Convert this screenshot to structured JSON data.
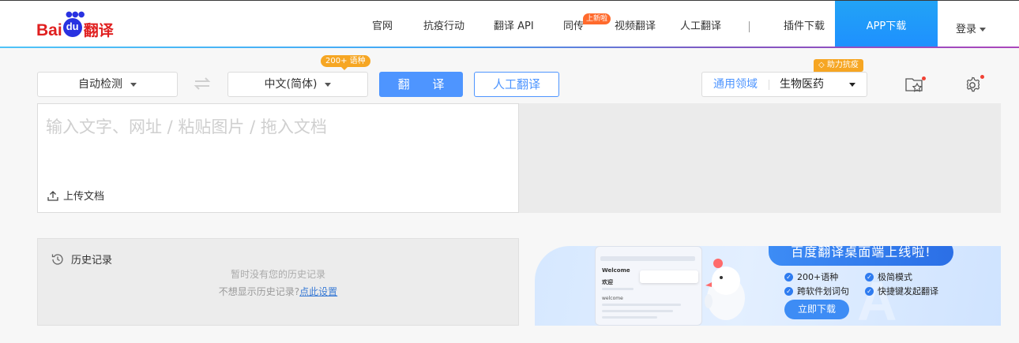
{
  "header": {
    "logo": {
      "bai": "Bai",
      "du": "du",
      "fanyi": "翻译"
    },
    "nav": [
      "官网",
      "抗疫行动",
      "翻译 API",
      "同传",
      "视频翻译",
      "人工翻译",
      "插件下载"
    ],
    "new_badge": "上新啦",
    "app_download": "APP下载",
    "login": "登录"
  },
  "toolbar": {
    "source_lang": "自动检测",
    "target_lang": "中文(简体)",
    "lang_count_badge": "200+ 语种",
    "translate_button": "翻 译",
    "human_translate_button": "人工翻译",
    "domain_label": "通用领域",
    "domain_value": "生物医药",
    "help_badge": "助力抗疫"
  },
  "input": {
    "placeholder": "输入文字、网址 / 粘贴图片 / 拖入文档",
    "upload_label": "上传文档"
  },
  "history": {
    "title": "历史记录",
    "empty_text": "暂时没有您的历史记录",
    "hint_text": "不想显示历史记录?",
    "settings_link": "点此设置"
  },
  "banner": {
    "title": "百度翻译桌面端上线啦!",
    "features": [
      "200+语种",
      "极简模式",
      "跨软件划词句",
      "快捷键发起翻译"
    ],
    "download_button": "立即下载",
    "mock_welcome": "Welcome",
    "mock_welcome_cn": "欢迎",
    "mock_welcome_lower": "welcome"
  },
  "colors": {
    "accent": "#4e95ff",
    "brand_red": "#e02020",
    "badge_orange": "#f6a623",
    "app_button": "#1e90ff"
  }
}
